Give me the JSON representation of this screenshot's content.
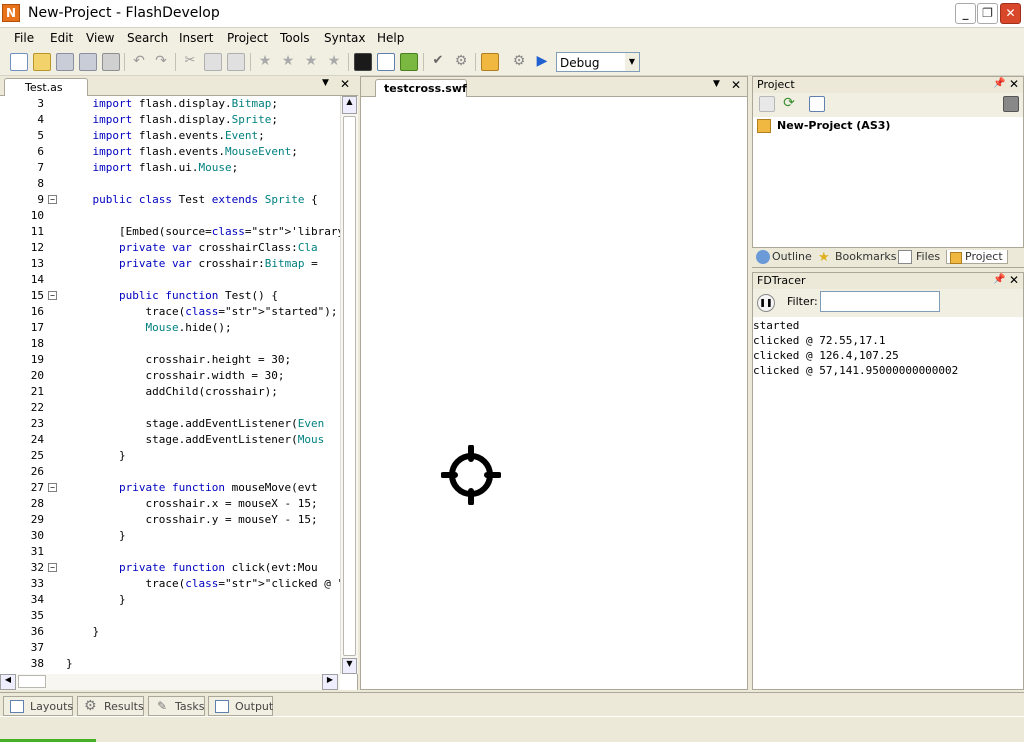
{
  "window": {
    "title": "New-Project - FlashDevelop"
  },
  "menu": [
    "File",
    "Edit",
    "View",
    "Search",
    "Insert",
    "Project",
    "Tools",
    "Syntax",
    "Help"
  ],
  "toolbar": {
    "config_value": "Debug"
  },
  "editor": {
    "tab_label": "Test.as",
    "lines": [
      {
        "n": "3",
        "t": "    import flash.display.Bitmap;"
      },
      {
        "n": "4",
        "t": "    import flash.display.Sprite;"
      },
      {
        "n": "5",
        "t": "    import flash.events.Event;"
      },
      {
        "n": "6",
        "t": "    import flash.events.MouseEvent;"
      },
      {
        "n": "7",
        "t": "    import flash.ui.Mouse;"
      },
      {
        "n": "8",
        "t": ""
      },
      {
        "n": "9",
        "t": "    public class Test extends Sprite {"
      },
      {
        "n": "10",
        "t": ""
      },
      {
        "n": "11",
        "t": "        [Embed(source='library/crosshai"
      },
      {
        "n": "12",
        "t": "        private var crosshairClass:Cla"
      },
      {
        "n": "13",
        "t": "        private var crosshair:Bitmap ="
      },
      {
        "n": "14",
        "t": ""
      },
      {
        "n": "15",
        "t": "        public function Test() {"
      },
      {
        "n": "16",
        "t": "            trace(\"started\");"
      },
      {
        "n": "17",
        "t": "            Mouse.hide();"
      },
      {
        "n": "18",
        "t": ""
      },
      {
        "n": "19",
        "t": "            crosshair.height = 30;"
      },
      {
        "n": "20",
        "t": "            crosshair.width = 30;"
      },
      {
        "n": "21",
        "t": "            addChild(crosshair);"
      },
      {
        "n": "22",
        "t": ""
      },
      {
        "n": "23",
        "t": "            stage.addEventListener(Even"
      },
      {
        "n": "24",
        "t": "            stage.addEventListener(Mous"
      },
      {
        "n": "25",
        "t": "        }"
      },
      {
        "n": "26",
        "t": ""
      },
      {
        "n": "27",
        "t": "        private function mouseMove(evt"
      },
      {
        "n": "28",
        "t": "            crosshair.x = mouseX - 15;"
      },
      {
        "n": "29",
        "t": "            crosshair.y = mouseY - 15;"
      },
      {
        "n": "30",
        "t": "        }"
      },
      {
        "n": "31",
        "t": ""
      },
      {
        "n": "32",
        "t": "        private function click(evt:Mou"
      },
      {
        "n": "33",
        "t": "            trace(\"clicked @ \" + evt.s"
      },
      {
        "n": "34",
        "t": "        }"
      },
      {
        "n": "35",
        "t": ""
      },
      {
        "n": "36",
        "t": "    }"
      },
      {
        "n": "37",
        "t": ""
      },
      {
        "n": "38",
        "t": "}"
      }
    ]
  },
  "swf": {
    "tab_label": "testcross.swf"
  },
  "project": {
    "title": "Project",
    "tree_item": "New-Project (AS3)"
  },
  "panel_tabs": [
    "Outline",
    "Bookmarks",
    "Files",
    "Project"
  ],
  "tracer": {
    "title": "FDTracer",
    "filter_label": "Filter:",
    "filter_value": "",
    "output": [
      "started",
      "clicked @ 72.55,17.1",
      "clicked @ 126.4,107.25",
      "clicked @ 57,141.95000000000002"
    ]
  },
  "bottom_tabs": [
    "Layouts",
    "Results",
    "Tasks",
    "Output"
  ]
}
